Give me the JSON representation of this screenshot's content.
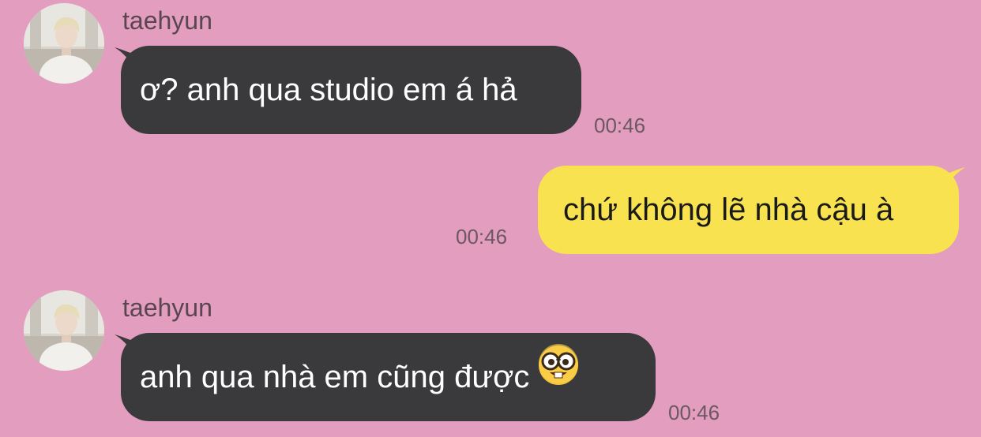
{
  "messages": [
    {
      "direction": "incoming",
      "sender": "taehyun",
      "text": "ơ? anh qua studio em á hả",
      "time": "00:46"
    },
    {
      "direction": "outgoing",
      "text": "chứ không lẽ nhà cậu à",
      "time": "00:46"
    },
    {
      "direction": "incoming",
      "sender": "taehyun",
      "text": "anh qua nhà em cũng được",
      "emoji": "nerd-face-emoji",
      "time": "00:46"
    }
  ],
  "colors": {
    "background": "#e39dbf",
    "incoming_bubble": "#3a3a3c",
    "outgoing_bubble": "#f9e24f"
  }
}
